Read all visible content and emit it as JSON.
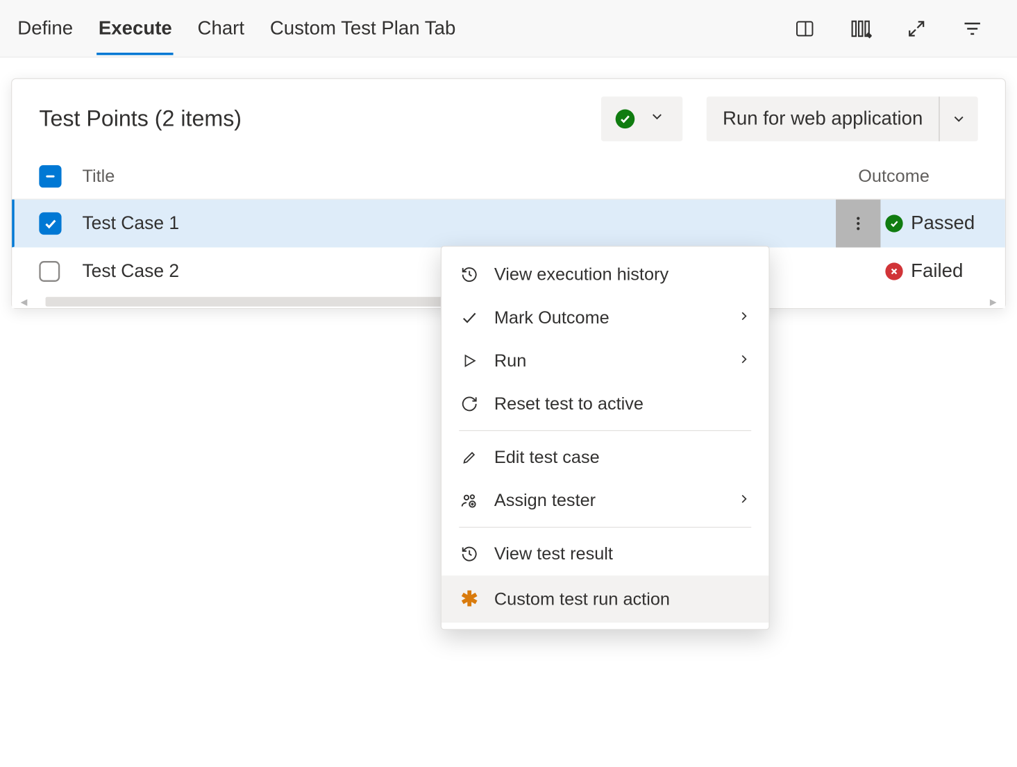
{
  "tabs": {
    "define": "Define",
    "execute": "Execute",
    "chart": "Chart",
    "custom": "Custom Test Plan Tab"
  },
  "panel": {
    "title": "Test Points (2 items)",
    "run_button_label": "Run for web application"
  },
  "columns": {
    "title": "Title",
    "outcome": "Outcome"
  },
  "rows": [
    {
      "title": "Test Case 1",
      "outcome": "Passed",
      "selected": true,
      "status": "pass"
    },
    {
      "title": "Test Case 2",
      "outcome": "Failed",
      "selected": false,
      "status": "fail"
    }
  ],
  "menu": {
    "view_history": "View execution history",
    "mark_outcome": "Mark Outcome",
    "run": "Run",
    "reset": "Reset test to active",
    "edit": "Edit test case",
    "assign": "Assign tester",
    "view_result": "View test result",
    "custom_action": "Custom test run action"
  }
}
